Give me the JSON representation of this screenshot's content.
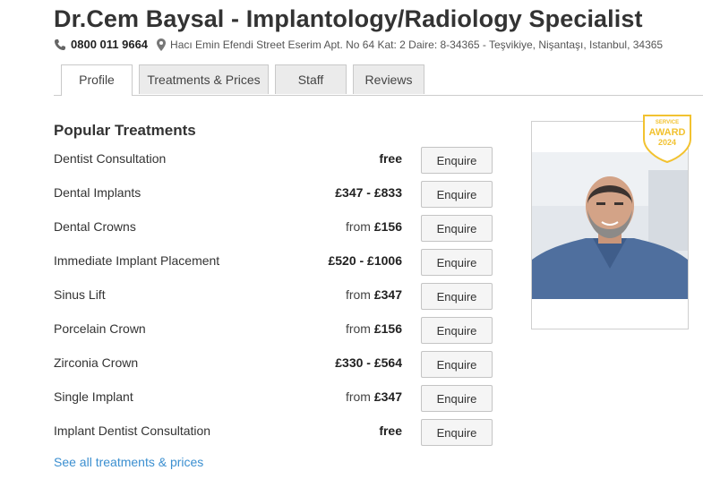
{
  "header": {
    "title": "Dr.Cem Baysal - Implantology/Radiology Specialist",
    "phone": "0800 011 9664",
    "address": "Hacı Emin Efendi Street Eserim Apt. No 64 Kat: 2 Daire: 8-34365 - Teşvikiye, Nişantaşı, Istanbul, 34365",
    "phone_icon": "phone-icon",
    "address_icon": "map-pin-icon"
  },
  "tabs": [
    {
      "label": "Profile",
      "active": true
    },
    {
      "label": "Treatments & Prices",
      "active": false
    },
    {
      "label": "Staff",
      "active": false
    },
    {
      "label": "Reviews",
      "active": false
    }
  ],
  "popular": {
    "title": "Popular Treatments",
    "enquire_label": "Enquire",
    "items": [
      {
        "name": "Dentist Consultation",
        "prefix": "",
        "price": "free"
      },
      {
        "name": "Dental Implants",
        "prefix": "",
        "price": "£347 - £833"
      },
      {
        "name": "Dental Crowns",
        "prefix": "from ",
        "price": "£156"
      },
      {
        "name": "Immediate Implant Placement",
        "prefix": "",
        "price": "£520 - £1006"
      },
      {
        "name": "Sinus Lift",
        "prefix": "from ",
        "price": "£347"
      },
      {
        "name": "Porcelain Crown",
        "prefix": "from ",
        "price": "£156"
      },
      {
        "name": "Zirconia Crown",
        "prefix": "",
        "price": "£330 - £564"
      },
      {
        "name": "Single Implant",
        "prefix": "from ",
        "price": "£347"
      },
      {
        "name": "Implant Dentist Consultation",
        "prefix": "",
        "price": "free"
      }
    ],
    "see_all": "See all treatments & prices"
  },
  "badge": {
    "line1": "SERVICE",
    "line2": "AWARD",
    "line3": "2024",
    "color": "#f2c230"
  },
  "colors": {
    "link": "#3b8fd0",
    "photo_background": "#dfe4ea",
    "scrubs": "#4f6f9e"
  }
}
